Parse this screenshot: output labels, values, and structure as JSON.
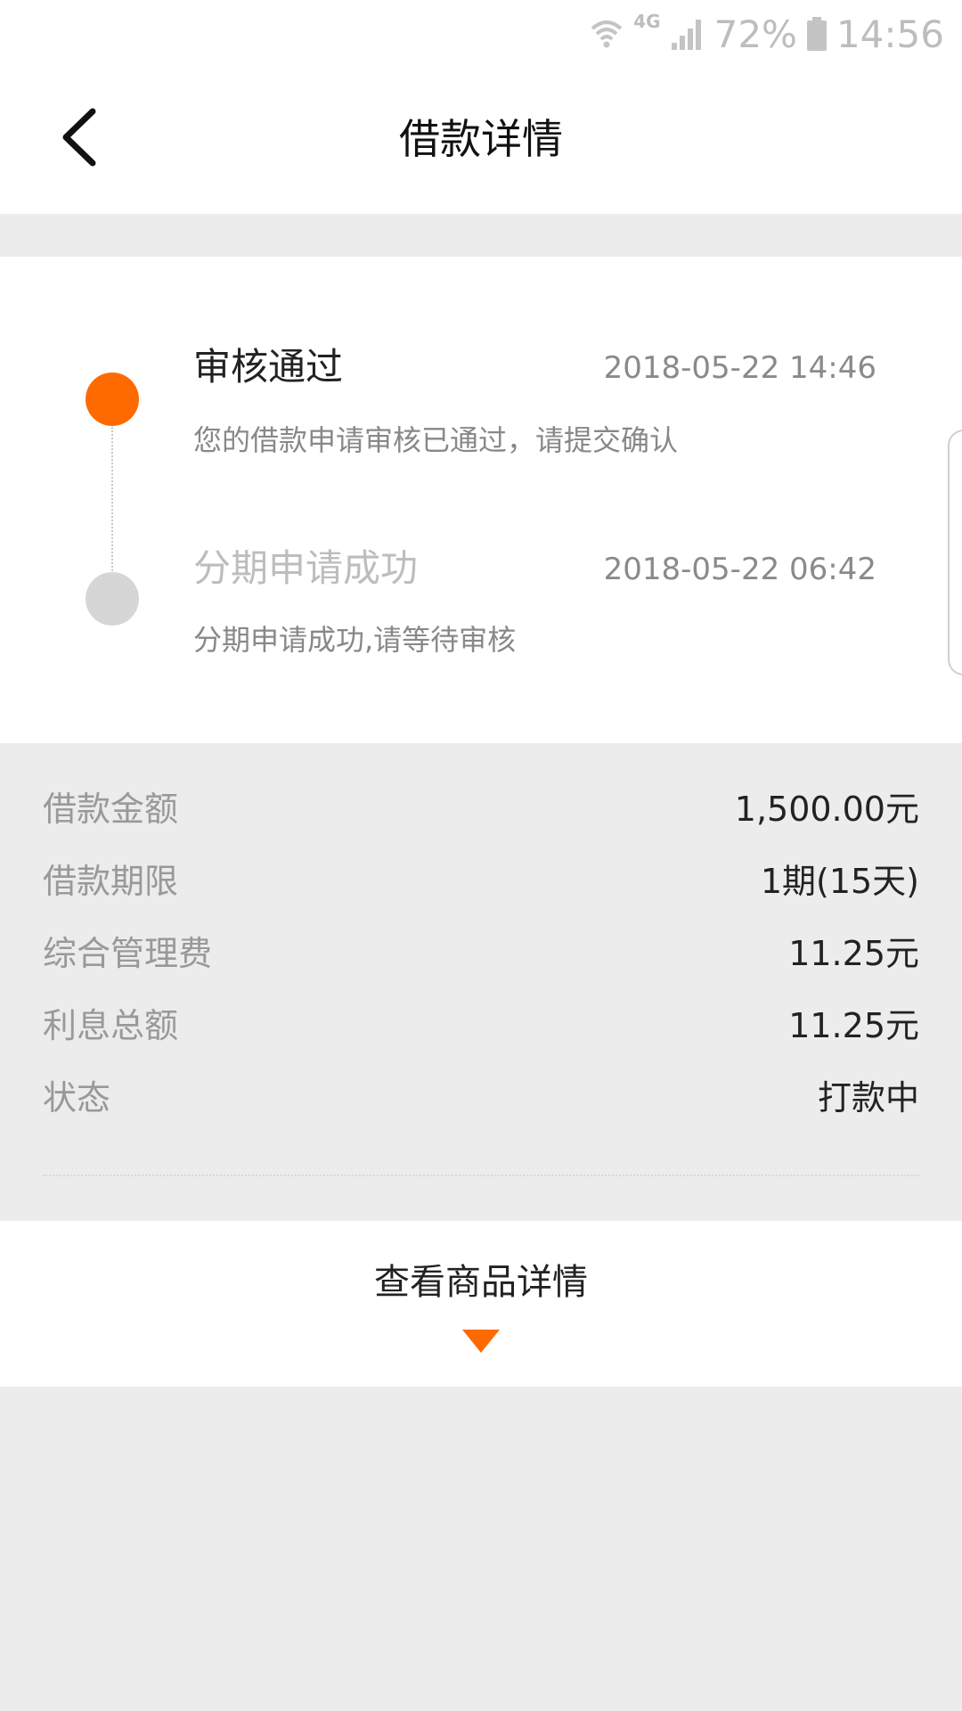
{
  "status_bar": {
    "network": "4G",
    "battery_percent": "72%",
    "time": "14:56"
  },
  "header": {
    "title": "借款详情"
  },
  "timeline": {
    "steps": [
      {
        "title": "审核通过",
        "time": "2018-05-22 14:46",
        "description": "您的借款申请审核已通过，请提交确认",
        "state": "active"
      },
      {
        "title": "分期申请成功",
        "time": "2018-05-22 06:42",
        "description": "分期申请成功,请等待审核",
        "state": "inactive"
      }
    ]
  },
  "details": {
    "rows": [
      {
        "label": "借款金额",
        "value": "1,500.00元"
      },
      {
        "label": "借款期限",
        "value": "1期(15天)"
      },
      {
        "label": "综合管理费",
        "value": "11.25元"
      },
      {
        "label": "利息总额",
        "value": "11.25元"
      },
      {
        "label": "状态",
        "value": "打款中"
      }
    ]
  },
  "product": {
    "button_label": "查看商品详情"
  },
  "colors": {
    "accent": "#ff6a00",
    "inactive": "#d6d6d6",
    "background": "#ececec"
  }
}
